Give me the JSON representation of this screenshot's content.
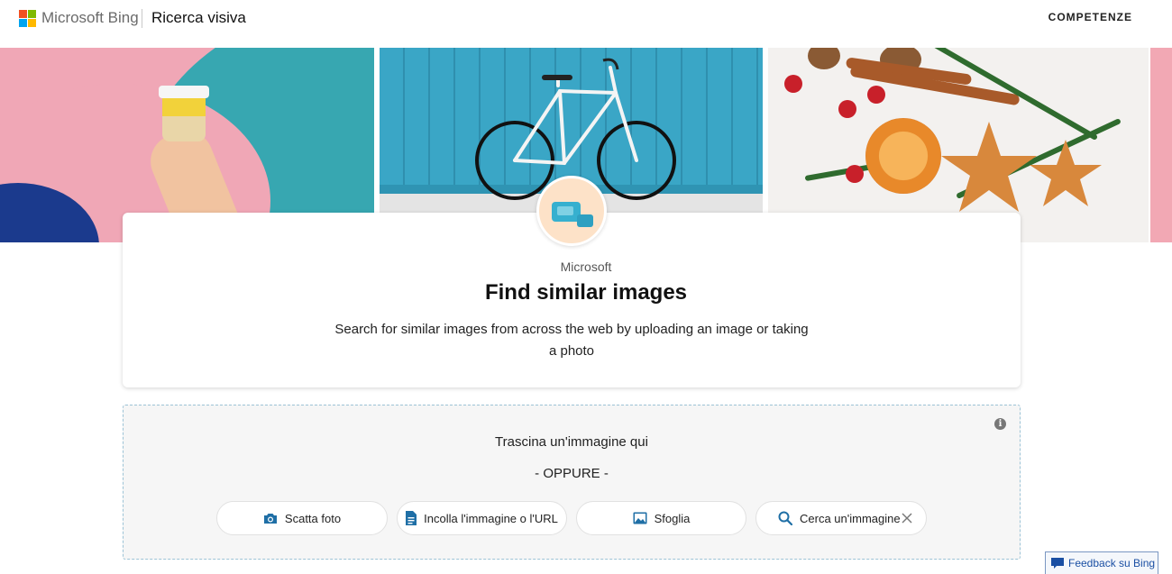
{
  "header": {
    "brand": "Microsoft Bing",
    "product": "Ricerca visiva",
    "nav_link": "COMPETENZE",
    "logo_colors": [
      "#f25022",
      "#7fba00",
      "#00a4ef",
      "#ffb900"
    ]
  },
  "hero": {
    "tiles": [
      "coffee-cup-pink-wall",
      "bicycle-blue-wall",
      "christmas-decorations"
    ]
  },
  "card": {
    "icon": "image-search-icon",
    "publisher": "Microsoft",
    "title": "Find similar images",
    "description": "Search for similar images from across the web by uploading an image or taking a photo"
  },
  "dropzone": {
    "drag_text": "Trascina un'immagine qui",
    "or_text": "- OPPURE -",
    "info_icon": "info-icon",
    "buttons": [
      {
        "label": "Scatta foto",
        "icon": "camera-icon"
      },
      {
        "label": "Incolla l'immagine o l'URL",
        "icon": "document-icon"
      },
      {
        "label": "Sfoglia",
        "icon": "image-icon"
      },
      {
        "label": "Cerca un'immagine",
        "icon": "search-icon"
      }
    ]
  },
  "feedback": {
    "label": "Feedback su Bing"
  },
  "colors": {
    "accent": "#1a6fa8",
    "dropzone_border": "#9cc3d6"
  }
}
